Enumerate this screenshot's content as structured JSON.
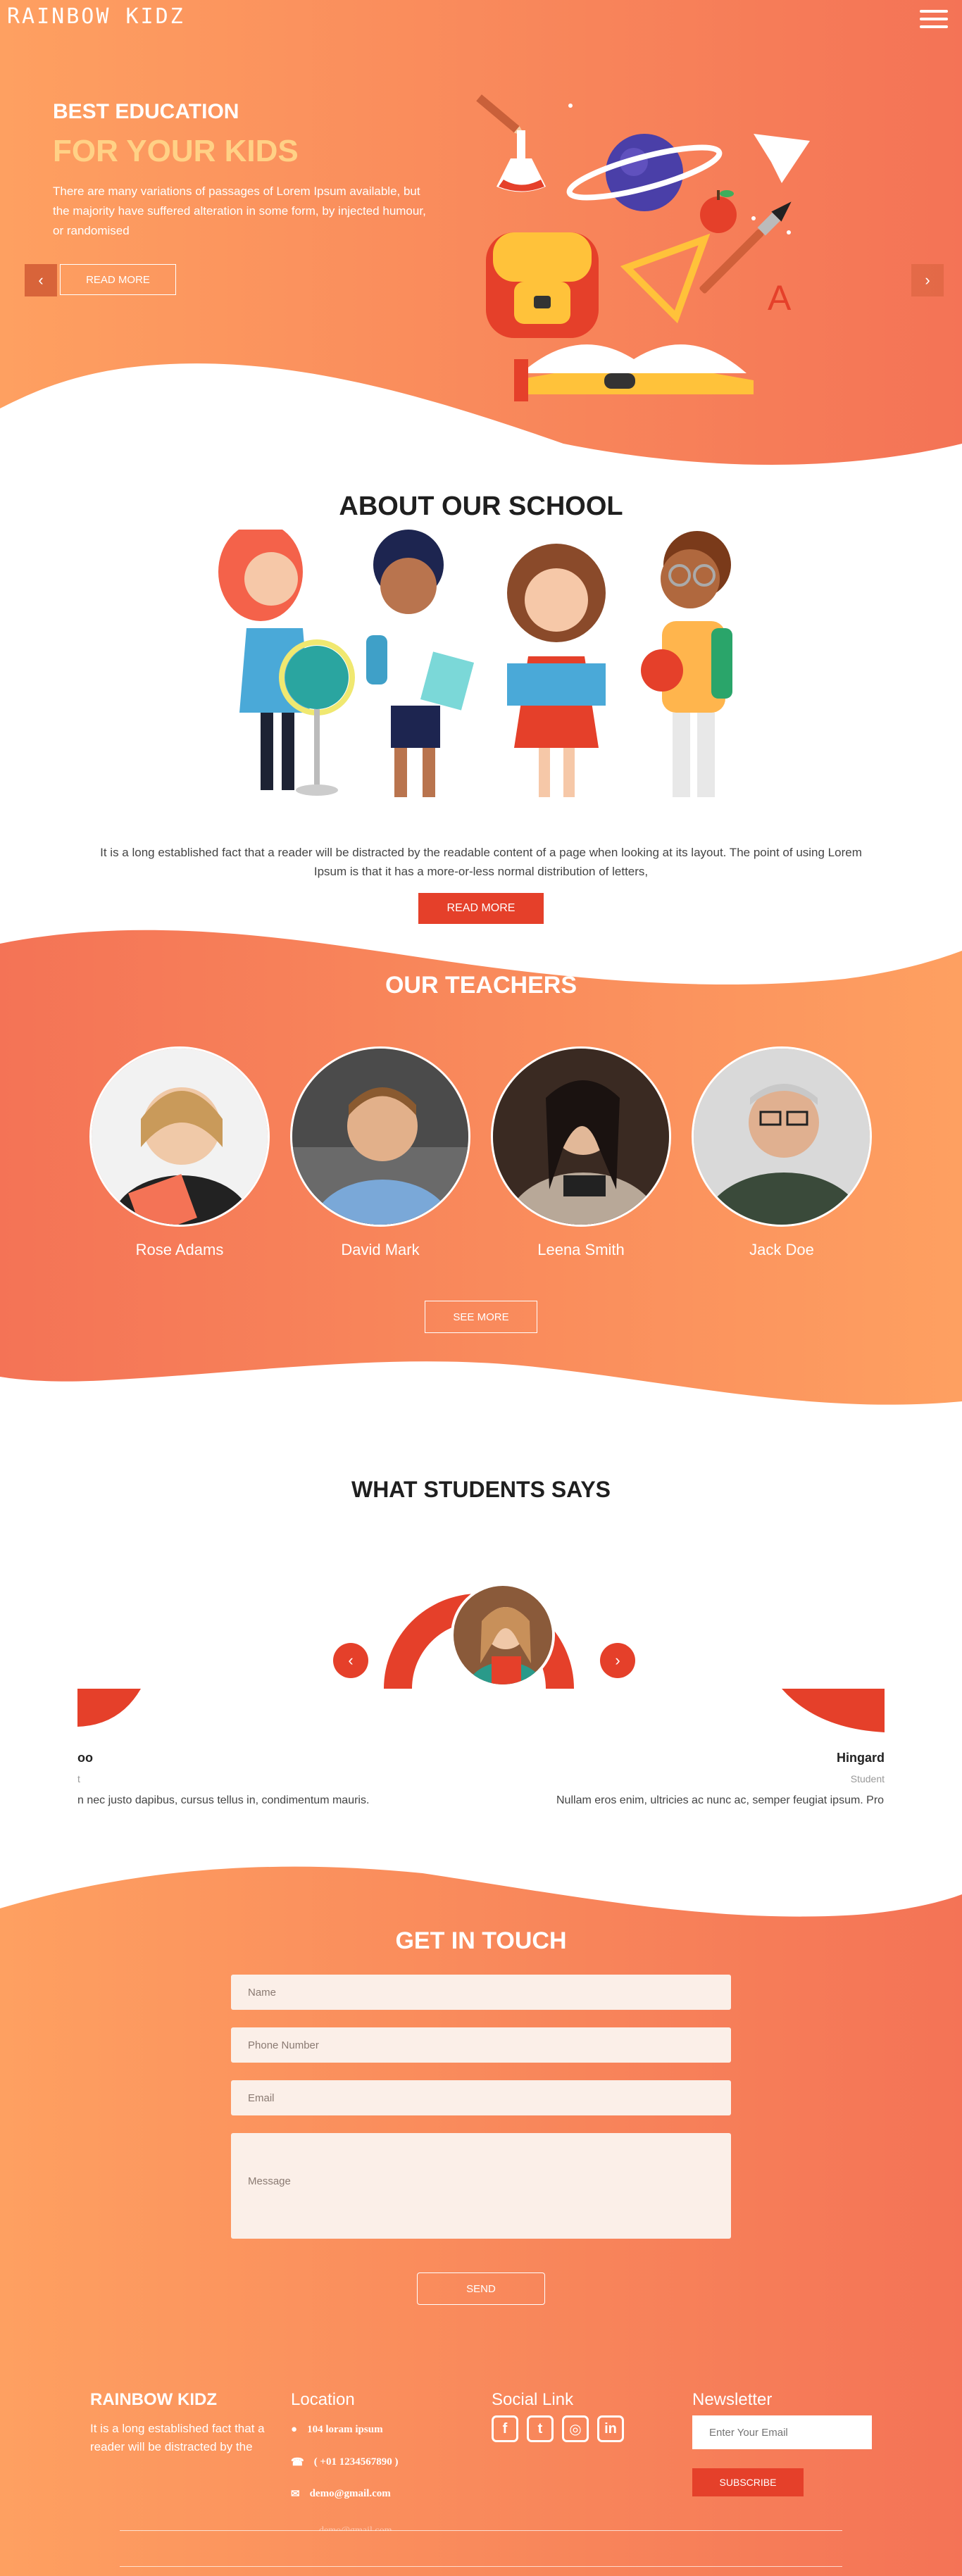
{
  "colors": {
    "gradient_start": "#fea061",
    "gradient_end": "#f47356",
    "accent_red": "#e5402a",
    "hero_highlight": "#ffd186"
  },
  "header": {
    "brand": "RAINBOW KIDZ",
    "menu_icon": "hamburger-menu-icon"
  },
  "hero": {
    "kicker": "BEST EDUCATION",
    "title": "FOR YOUR KIDS",
    "text": "There are many variations of passages of Lorem Ipsum available, but the majority have suffered alteration in some form, by injected humour, or randomised",
    "button": "READ MORE",
    "prev_icon": "‹",
    "next_icon": "›"
  },
  "about": {
    "title": "ABOUT OUR SCHOOL",
    "text": "It is a long established fact that a reader will be distracted by the readable content of a page when looking at its layout. The point of using Lorem Ipsum is that it has a more-or-less normal distribution of letters,",
    "button": "READ MORE"
  },
  "teachers": {
    "title": "OUR TEACHERS",
    "items": [
      {
        "name": "Rose Adams"
      },
      {
        "name": "David Mark"
      },
      {
        "name": "Leena Smith"
      },
      {
        "name": "Jack Doe"
      }
    ],
    "button": "SEE MORE"
  },
  "testimonials": {
    "title": "WHAT STUDENTS SAYS",
    "left_name": "oo",
    "left_role": "t",
    "left_text": "n nec justo dapibus, cursus tellus in, condimentum mauris.",
    "right_name": "Hingard",
    "right_role": "Student",
    "right_text": "Nullam eros enim, ultricies ac nunc ac, semper feugiat ipsum. Proi",
    "prev_icon": "‹",
    "next_icon": "›"
  },
  "contact": {
    "title": "GET IN TOUCH",
    "name_placeholder": "Name",
    "phone_placeholder": "Phone Number",
    "email_placeholder": "Email",
    "message_placeholder": "Message",
    "button": "SEND"
  },
  "footer": {
    "brand": "RAINBOW KIDZ",
    "about_text": "It is a long established fact that a reader will be distracted by the",
    "location_title": "Location",
    "address": "104 loram ipsum",
    "phone": "( +01 1234567890 )",
    "email": "demo@gmail.com",
    "email_overflow": "demo@gmail.com",
    "social_title": "Social Link",
    "social_icons": [
      "facebook-icon",
      "twitter-icon",
      "instagram-icon",
      "linkedin-icon"
    ],
    "newsletter_title": "Newsletter",
    "newsletter_placeholder": "Enter Your Email",
    "subscribe": "SUBSCRIBE"
  }
}
